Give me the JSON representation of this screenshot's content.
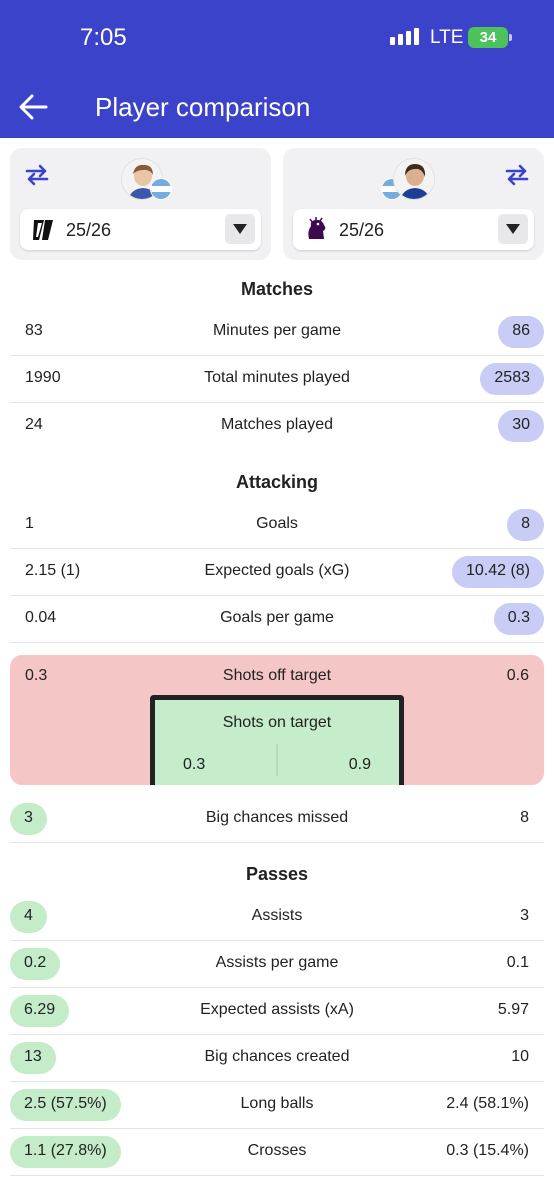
{
  "status_bar": {
    "time": "7:05",
    "network": "LTE",
    "battery": "34"
  },
  "header": {
    "title": "Player comparison"
  },
  "players": {
    "left": {
      "season": "25/26",
      "league_logo": "ligue-1-logo",
      "nationality_flag": "argentina-flag"
    },
    "right": {
      "season": "25/26",
      "league_logo": "premier-league-logo",
      "nationality_flag": "argentina-flag"
    }
  },
  "sections": {
    "matches": {
      "title": "Matches",
      "rows": [
        {
          "label": "Minutes per game",
          "left": "83",
          "right": "86"
        },
        {
          "label": "Total minutes played",
          "left": "1990",
          "right": "2583"
        },
        {
          "label": "Matches played",
          "left": "24",
          "right": "30"
        }
      ]
    },
    "attacking": {
      "title": "Attacking",
      "rows": [
        {
          "label": "Goals",
          "left": "1",
          "right": "8"
        },
        {
          "label": "Expected goals (xG)",
          "left": "2.15 (1)",
          "right": "10.42 (8)"
        },
        {
          "label": "Goals per game",
          "left": "0.04",
          "right": "0.3"
        }
      ],
      "shots": {
        "off_label": "Shots off target",
        "off_left": "0.3",
        "off_right": "0.6",
        "on_label": "Shots on target",
        "on_left": "0.3",
        "on_right": "0.9"
      },
      "big_chances_missed": {
        "label": "Big chances missed",
        "left": "3",
        "right": "8"
      }
    },
    "passes": {
      "title": "Passes",
      "rows": [
        {
          "label": "Assists",
          "left": "4",
          "right": "3"
        },
        {
          "label": "Assists per game",
          "left": "0.2",
          "right": "0.1"
        },
        {
          "label": "Expected assists (xA)",
          "left": "6.29",
          "right": "5.97"
        },
        {
          "label": "Big chances created",
          "left": "13",
          "right": "10"
        },
        {
          "label": "Long balls",
          "left": "2.5 (57.5%)",
          "right": "2.4 (58.1%)"
        },
        {
          "label": "Crosses",
          "left": "1.1 (27.8%)",
          "right": "0.3 (15.4%)"
        }
      ]
    }
  },
  "colors": {
    "header": "#3a43c9",
    "right_highlight": "#c9ccf4",
    "left_highlight": "#c4ecc9",
    "shots_off": "#f4c6c6",
    "shots_on": "#c5eccb"
  }
}
